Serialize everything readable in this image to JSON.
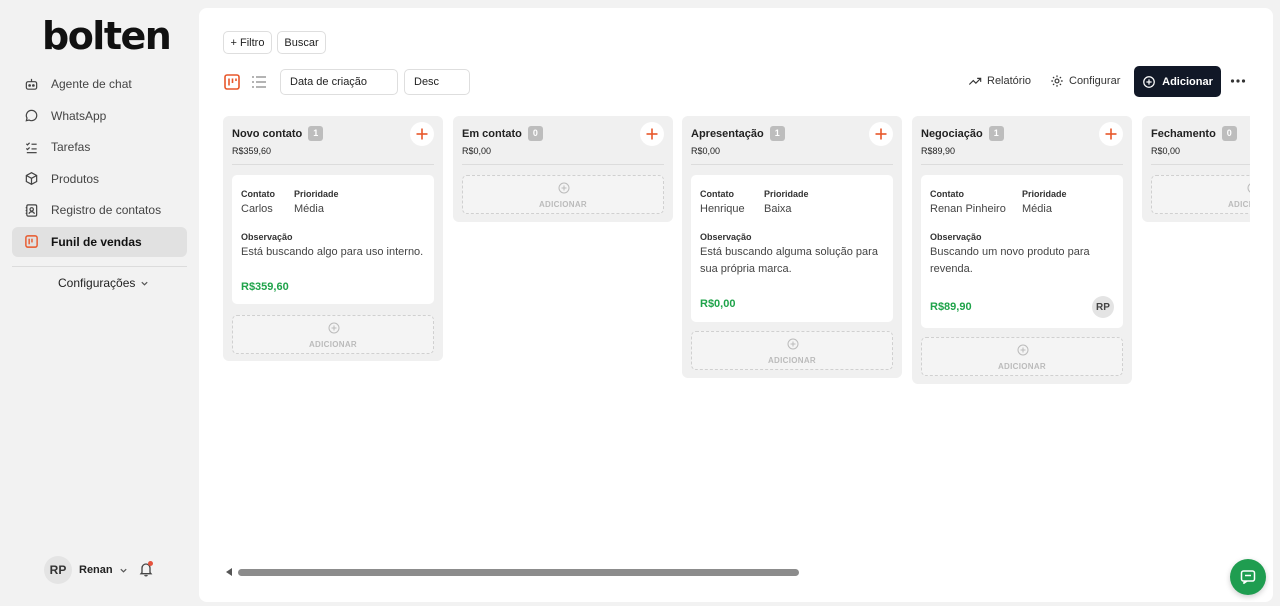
{
  "brand": {
    "logo": "bolten"
  },
  "sidebar": {
    "items": [
      {
        "label": "Agente de chat",
        "icon": "bot-icon"
      },
      {
        "label": "WhatsApp",
        "icon": "chat-bubble-icon"
      },
      {
        "label": "Tarefas",
        "icon": "checklist-icon"
      },
      {
        "label": "Produtos",
        "icon": "box-icon"
      },
      {
        "label": "Registro de contatos",
        "icon": "contacts-icon"
      },
      {
        "label": "Funil de vendas",
        "icon": "kanban-icon",
        "active": true
      }
    ],
    "config_label": "Configurações",
    "user": {
      "initials": "RP",
      "name": "Renan"
    }
  },
  "toolbar": {
    "filter_label": "+ Filtro",
    "search_label": "Buscar",
    "sort_field": "Data de criação",
    "sort_order": "Desc",
    "report_label": "Relatório",
    "configure_label": "Configurar",
    "add_label": "Adicionar"
  },
  "board": {
    "columns": [
      {
        "title": "Novo contato",
        "count": "1",
        "total": "R$359,60",
        "cards": [
          {
            "contact_label": "Contato",
            "contact": "Carlos",
            "priority_label": "Prioridade",
            "priority": "Média",
            "note_label": "Observação",
            "note": "Está buscando algo para uso interno.",
            "value": "R$359,60"
          }
        ]
      },
      {
        "title": "Em contato",
        "count": "0",
        "total": "R$0,00",
        "cards": []
      },
      {
        "title": "Apresentação",
        "count": "1",
        "total": "R$0,00",
        "cards": [
          {
            "contact_label": "Contato",
            "contact": "Henrique",
            "priority_label": "Prioridade",
            "priority": "Baixa",
            "note_label": "Observação",
            "note": "Está buscando alguma solução para sua própria marca.",
            "value": "R$0,00"
          }
        ]
      },
      {
        "title": "Negociação",
        "count": "1",
        "total": "R$89,90",
        "cards": [
          {
            "contact_label": "Contato",
            "contact": "Renan Pinheiro",
            "priority_label": "Prioridade",
            "priority": "Média",
            "note_label": "Observação",
            "note": "Buscando um novo produto para revenda.",
            "value": "R$89,90",
            "assignee": "RP"
          }
        ]
      },
      {
        "title": "Fechamento",
        "count": "0",
        "total": "R$0,00",
        "cards": []
      }
    ],
    "add_zone_label": "ADICIONAR"
  },
  "colors": {
    "accent": "#e8572a",
    "primary_button": "#111827",
    "price": "#1fa34a",
    "chat_fab": "#1f9d50"
  }
}
